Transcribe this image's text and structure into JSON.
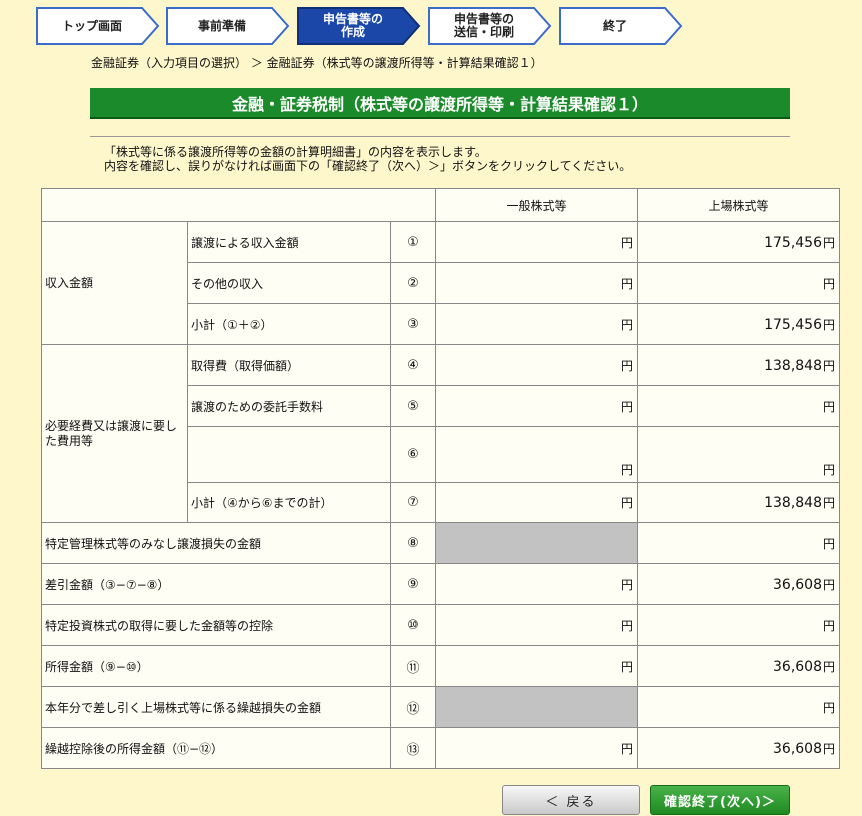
{
  "steps": [
    {
      "label": "トップ画面",
      "state": "inactive"
    },
    {
      "label": "事前準備",
      "state": "inactive"
    },
    {
      "label": "申告書等の\n作成",
      "state": "active"
    },
    {
      "label": "申告書等の\n送信・印刷",
      "state": "inactive"
    },
    {
      "label": "終了",
      "state": "inactive"
    }
  ],
  "breadcrumb": "金融証券（入力項目の選択） ＞ 金融証券（株式等の譲渡所得等・計算結果確認１）",
  "title": "金融・証券税制（株式等の譲渡所得等・計算結果確認１）",
  "instructions": {
    "line1": "「株式等に係る譲渡所得等の金額の計算明細書」の内容を表示します。",
    "line2": "内容を確認し、誤りがなければ画面下の「確認終了（次へ）＞」ボタンをクリックしてください。"
  },
  "table": {
    "columns": {
      "general": "一般株式等",
      "listed": "上場株式等"
    },
    "unit": "円",
    "groups": {
      "income": "収入金額",
      "expenses": "必要経費又は譲渡に要した費用等"
    },
    "rows": [
      {
        "label": "譲渡による収入金額",
        "num": "①",
        "general": "",
        "listed": "175,456"
      },
      {
        "label": "その他の収入",
        "num": "②",
        "general": "",
        "listed": ""
      },
      {
        "label": "小計（①＋②）",
        "num": "③",
        "general": "",
        "listed": "175,456"
      },
      {
        "label": "取得費（取得価額）",
        "num": "④",
        "general": "",
        "listed": "138,848"
      },
      {
        "label": "譲渡のための委託手数料",
        "num": "⑤",
        "general": "",
        "listed": ""
      },
      {
        "label": "",
        "num": "⑥",
        "general": "",
        "listed": ""
      },
      {
        "label": "小計（④から⑥までの計）",
        "num": "⑦",
        "general": "",
        "listed": "138,848"
      },
      {
        "label": "特定管理株式等のみなし譲渡損失の金額",
        "num": "⑧",
        "general": null,
        "listed": ""
      },
      {
        "label": "差引金額（③−⑦−⑧）",
        "num": "⑨",
        "general": "",
        "listed": "36,608"
      },
      {
        "label": "特定投資株式の取得に要した金額等の控除",
        "num": "⑩",
        "general": "",
        "listed": ""
      },
      {
        "label": "所得金額（⑨−⑩）",
        "num": "⑪",
        "general": "",
        "listed": "36,608"
      },
      {
        "label": "本年分で差し引く上場株式等に係る繰越損失の金額",
        "num": "⑫",
        "general": null,
        "listed": ""
      },
      {
        "label": "繰越控除後の所得金額（⑪−⑫）",
        "num": "⑬",
        "general": "",
        "listed": "36,608"
      }
    ]
  },
  "buttons": {
    "back": "＜ 戻る",
    "next": "確認終了(次へ)＞"
  },
  "colors": {
    "page_bg": "#fff7cc",
    "title_bar": "#1b8a2a",
    "active_step": "#1a47a8",
    "inactive_step_border": "#3b6cc7",
    "disabled_cell": "#c2c2c2"
  }
}
